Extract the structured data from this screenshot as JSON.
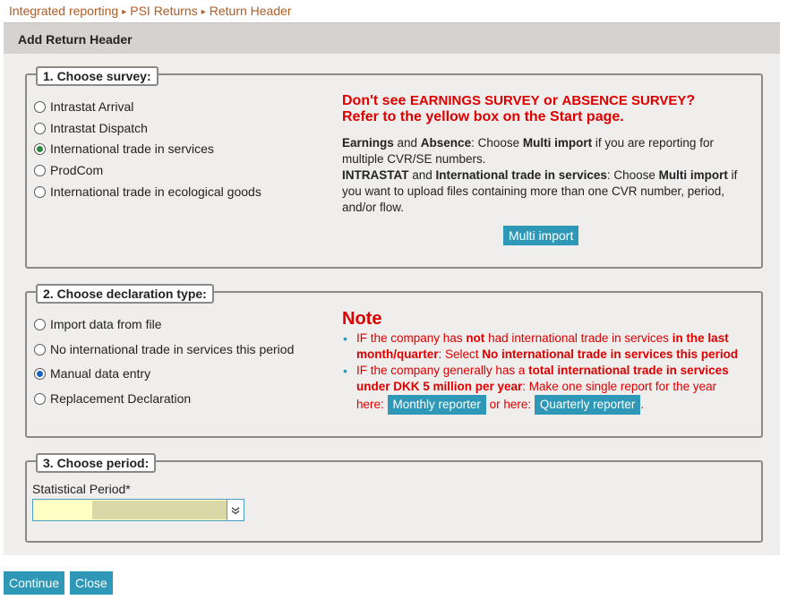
{
  "breadcrumb": [
    "Integrated reporting",
    "PSI Returns",
    "Return Header"
  ],
  "header": {
    "title": "Add Return Header"
  },
  "survey": {
    "legend": "1. Choose survey:",
    "options": [
      "Intrastat Arrival",
      "Intrastat Dispatch",
      "International trade in services",
      "ProdCom",
      "International trade in ecological goods"
    ],
    "selected_index": 2,
    "warning": {
      "line1_a": "Don't see ",
      "line1_b": "EARNINGS SURVEY",
      "line1_c": " or ",
      "line1_d": "ABSENCE SURVEY",
      "line1_e": "?",
      "line2": "Refer to the yellow box on the Start page."
    },
    "info": {
      "p1_b1": "Earnings",
      "p1_t1": " and ",
      "p1_b2": "Absence",
      "p1_t2": ": Choose ",
      "p1_b3": "Multi import",
      "p1_t3": " if you are reporting for multiple CVR/SE numbers.",
      "p2_b1": "INTRASTAT",
      "p2_t1": " and ",
      "p2_b2": "International trade in services",
      "p2_t2": ": Choose ",
      "p2_b3": "Multi import",
      "p2_t3": " if you want to upload files containing more than one CVR number, period, and/or flow."
    },
    "multi_import_label": "Multi import"
  },
  "declaration": {
    "legend": "2. Choose declaration type:",
    "options": [
      "Import data from file",
      "No international trade in services this period",
      "Manual data entry",
      "Replacement Declaration"
    ],
    "selected_index": 2,
    "note_title": "Note",
    "note1": {
      "t1": "IF the company has ",
      "b1": "not",
      "t2": " had international trade in services ",
      "b2": "in the last month/quarter",
      "t3": ": Select ",
      "b3": "No international trade in services this period"
    },
    "note2": {
      "t1": "IF the company generally has a ",
      "b1": "total international trade in services under DKK 5 million per year",
      "t2": ": Make one single report for the year here: ",
      "btn1": "Monthly reporter",
      "t3": " or here: ",
      "btn2": "Quarterly reporter",
      "t4": "."
    }
  },
  "period": {
    "legend": "3. Choose period:",
    "label": "Statistical Period*",
    "value": ""
  },
  "footer": {
    "continue_label": "Continue",
    "close_label": "Close"
  },
  "colors": {
    "accent": "#2e98b6",
    "warning": "#dd0000",
    "breadcrumb": "#b25b1f",
    "selected_radio": "#2b8a3e"
  }
}
